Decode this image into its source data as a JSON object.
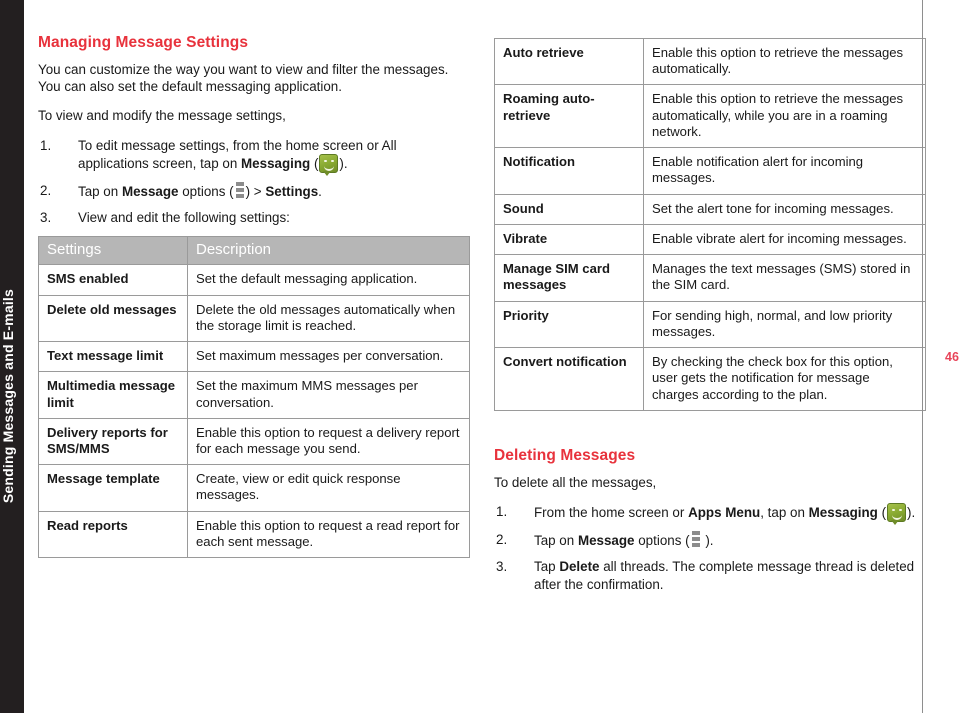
{
  "sidebar": {
    "label": "Sending Messages and E-mails"
  },
  "page_number": "46",
  "left_column": {
    "heading": "Managing Message Settings",
    "intro": "You can customize the way you want to view and filter the messages. You can also set the default messaging application.",
    "lead_in": "To view and modify the message settings,",
    "steps": [
      {
        "num": "1.",
        "parts": [
          {
            "t": "To edit message settings, from the home screen or All applications screen, tap on ",
            "b": false
          },
          {
            "t": "Messaging",
            "b": true
          },
          {
            "t": " (",
            "b": false
          },
          {
            "t": "messaging-app-icon",
            "icon": "messaging"
          },
          {
            "t": ").",
            "b": false
          }
        ]
      },
      {
        "num": "2.",
        "parts": [
          {
            "t": "Tap on ",
            "b": false
          },
          {
            "t": "Message",
            "b": true
          },
          {
            "t": " options (",
            "b": false
          },
          {
            "t": "overflow-menu-icon",
            "icon": "dots"
          },
          {
            "t": ") > ",
            "b": false
          },
          {
            "t": "Settings",
            "b": true
          },
          {
            "t": ".",
            "b": false
          }
        ]
      },
      {
        "num": "3.",
        "parts": [
          {
            "t": "View and edit the following settings:",
            "b": false
          }
        ]
      }
    ],
    "table": {
      "headers": [
        "Settings",
        "Description"
      ],
      "rows": [
        {
          "setting": "SMS enabled",
          "description": "Set the default messaging application."
        },
        {
          "setting": "Delete old messages",
          "description": "Delete the old messages automatically when the storage limit is reached."
        },
        {
          "setting": "Text message limit",
          "description": "Set maximum messages per conversation."
        },
        {
          "setting": "Multimedia message limit",
          "description": "Set the maximum MMS messages per conversation."
        },
        {
          "setting": "Delivery reports for SMS/MMS",
          "description": "Enable this option to request a delivery report for each message you send."
        },
        {
          "setting": "Message template",
          "description": "Create, view or edit quick response messages."
        },
        {
          "setting": "Read reports",
          "description": "Enable this option to request a read report for each sent message."
        }
      ]
    }
  },
  "right_column": {
    "table": {
      "rows": [
        {
          "setting": "Auto retrieve",
          "description": "Enable this option to retrieve the messages automatically."
        },
        {
          "setting": "Roaming auto-retrieve",
          "description": "Enable this option to retrieve the messages automatically, while you are in a roaming network."
        },
        {
          "setting": "Notification",
          "description": "Enable notification alert for incoming messages."
        },
        {
          "setting": "Sound",
          "description": "Set the alert tone for incoming messages."
        },
        {
          "setting": "Vibrate",
          "description": "Enable vibrate alert for incoming messages."
        },
        {
          "setting": "Manage SIM card messages",
          "description": "Manages the text messages (SMS) stored in the SIM card."
        },
        {
          "setting": "Priority",
          "description": "For sending high, normal, and low priority messages."
        },
        {
          "setting": "Convert notification",
          "description": "By checking the check box for this option, user gets the notification for message charges according to the plan."
        }
      ]
    },
    "heading": "Deleting Messages",
    "lead_in": "To delete all the messages,",
    "steps": [
      {
        "num": "1.",
        "parts": [
          {
            "t": "From the home screen or ",
            "b": false
          },
          {
            "t": "Apps Menu",
            "b": true
          },
          {
            "t": ", tap on ",
            "b": false
          },
          {
            "t": "Messaging",
            "b": true
          },
          {
            "t": " (",
            "b": false
          },
          {
            "t": "messaging-app-icon",
            "icon": "messaging"
          },
          {
            "t": ").",
            "b": false
          }
        ]
      },
      {
        "num": "2.",
        "parts": [
          {
            "t": "Tap on ",
            "b": false
          },
          {
            "t": "Message",
            "b": true
          },
          {
            "t": " options (",
            "b": false
          },
          {
            "t": "overflow-menu-icon",
            "icon": "dots"
          },
          {
            "t": " ).",
            "b": false
          }
        ]
      },
      {
        "num": "3.",
        "parts": [
          {
            "t": "Tap ",
            "b": false
          },
          {
            "t": "Delete",
            "b": true
          },
          {
            "t": " all threads. The complete message thread is deleted after the confirmation.",
            "b": false
          }
        ]
      }
    ]
  },
  "colors": {
    "heading_red": "#e8323c",
    "page_number_red": "#e8455a",
    "table_header_gray": "#b6b6b6",
    "sidebar_black": "#231f20"
  }
}
